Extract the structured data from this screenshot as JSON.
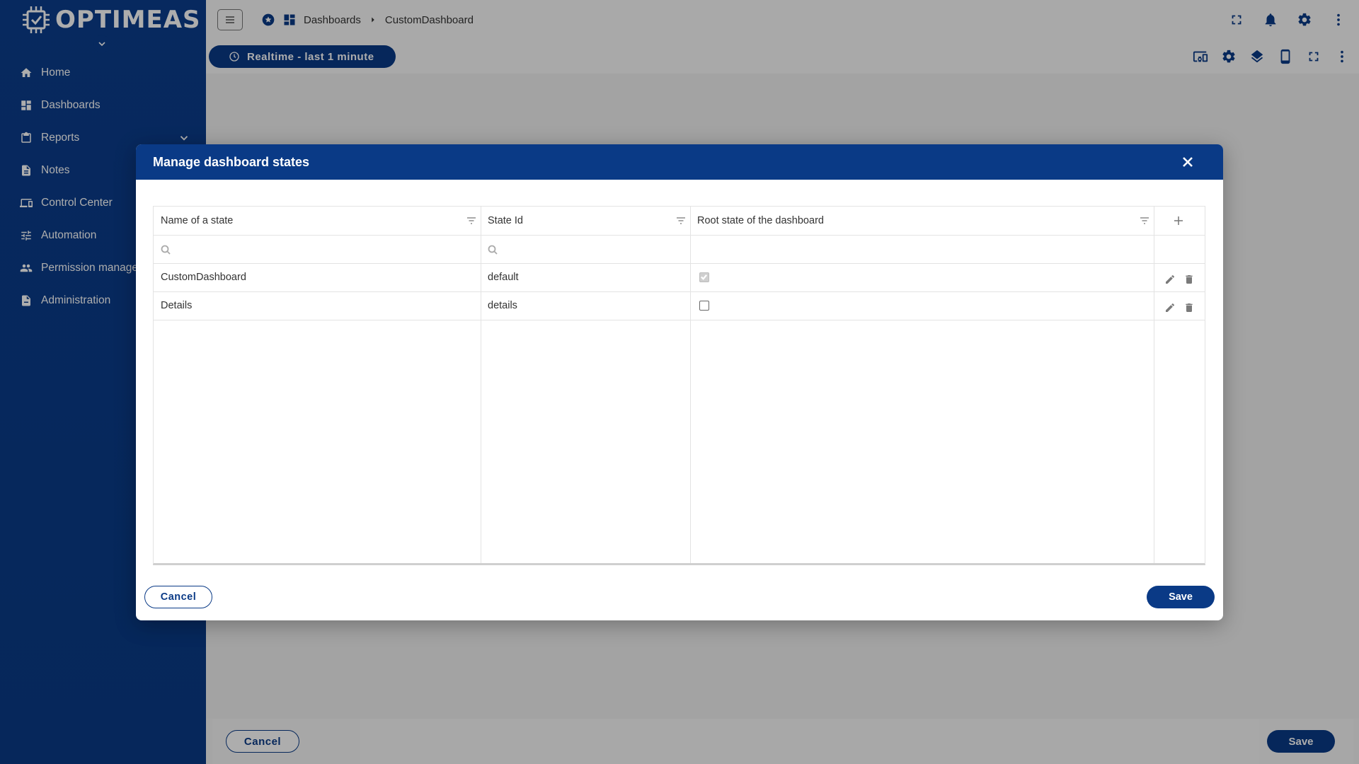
{
  "app": {
    "logo_text": "OPTIMEAS"
  },
  "sidebar": {
    "items": [
      {
        "label": "Home",
        "icon": "home-icon"
      },
      {
        "label": "Dashboards",
        "icon": "dashboard-icon"
      },
      {
        "label": "Reports",
        "icon": "clipboard-icon",
        "expandable": true
      },
      {
        "label": "Notes",
        "icon": "note-icon"
      },
      {
        "label": "Control Center",
        "icon": "devices-icon"
      },
      {
        "label": "Automation",
        "icon": "tune-icon"
      },
      {
        "label": "Permission management",
        "icon": "people-icon"
      },
      {
        "label": "Administration",
        "icon": "admin-icon"
      }
    ]
  },
  "header": {
    "breadcrumb": [
      "Dashboards",
      "CustomDashboard"
    ]
  },
  "toolbar": {
    "timewindow_label": "Realtime - last 1 minute"
  },
  "page_footer": {
    "cancel_label": "Cancel",
    "save_label": "Save"
  },
  "dialog": {
    "title": "Manage dashboard states",
    "columns": [
      "Name of a state",
      "State Id",
      "Root state of the dashboard"
    ],
    "rows": [
      {
        "name": "CustomDashboard",
        "state_id": "default",
        "root": true
      },
      {
        "name": "Details",
        "state_id": "details",
        "root": false
      }
    ],
    "cancel_label": "Cancel",
    "save_label": "Save"
  },
  "colors": {
    "brand": "#0a3a86",
    "overlay": "rgba(0,0,0,0.32)"
  }
}
